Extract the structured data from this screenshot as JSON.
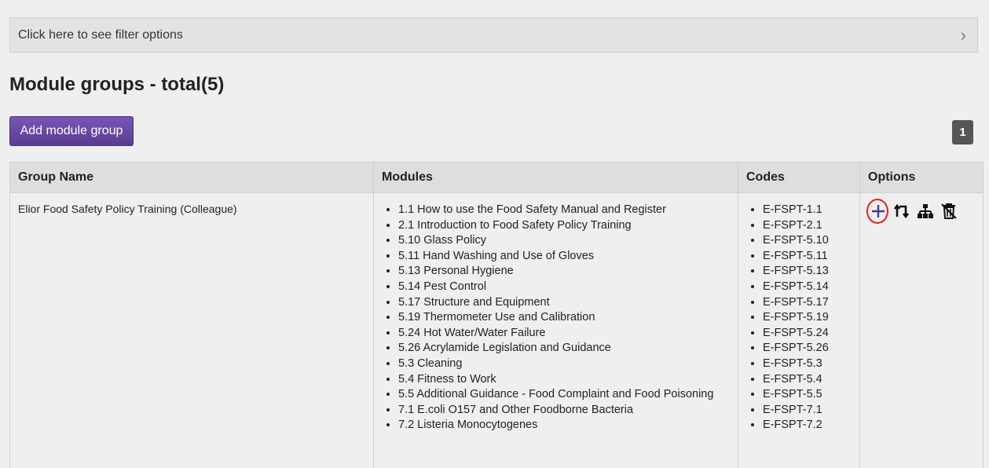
{
  "filter": {
    "label": "Click here to see filter options"
  },
  "page": {
    "title": "Module groups - total(5)"
  },
  "toolbar": {
    "add_label": "Add module group"
  },
  "pagination": {
    "current": "1"
  },
  "table": {
    "headers": {
      "name": "Group Name",
      "modules": "Modules",
      "codes": "Codes",
      "options": "Options"
    },
    "rows": [
      {
        "name": "Elior Food Safety Policy Training (Colleague)",
        "modules": [
          "1.1 How to use the Food Safety Manual and Register",
          "2.1 Introduction to Food Safety Policy Training",
          "5.10 Glass Policy",
          "5.11 Hand Washing and Use of Gloves",
          "5.13 Personal Hygiene",
          "5.14 Pest Control",
          "5.17 Structure and Equipment",
          "5.19 Thermometer Use and Calibration",
          "5.24 Hot Water/Water Failure",
          "5.26 Acrylamide Legislation and Guidance",
          "5.3 Cleaning",
          "5.4 Fitness to Work",
          "5.5 Additional Guidance - Food Complaint and Food Poisoning",
          "7.1 E.coli O157 and Other Foodborne Bacteria",
          "7.2 Listeria Monocytogenes"
        ],
        "codes": [
          "E-FSPT-1.1",
          "E-FSPT-2.1",
          "E-FSPT-5.10",
          "E-FSPT-5.11",
          "E-FSPT-5.13",
          "E-FSPT-5.14",
          "E-FSPT-5.17",
          "E-FSPT-5.19",
          "E-FSPT-5.24",
          "E-FSPT-5.26",
          "E-FSPT-5.3",
          "E-FSPT-5.4",
          "E-FSPT-5.5",
          "E-FSPT-7.1",
          "E-FSPT-7.2"
        ],
        "options": [
          "plus-icon",
          "reorder-icon",
          "hierarchy-icon",
          "delete-icon"
        ]
      }
    ]
  },
  "colors": {
    "accent": "#6a48a6",
    "highlight": "#e02020",
    "plus_icon": "#4a3a8c"
  }
}
